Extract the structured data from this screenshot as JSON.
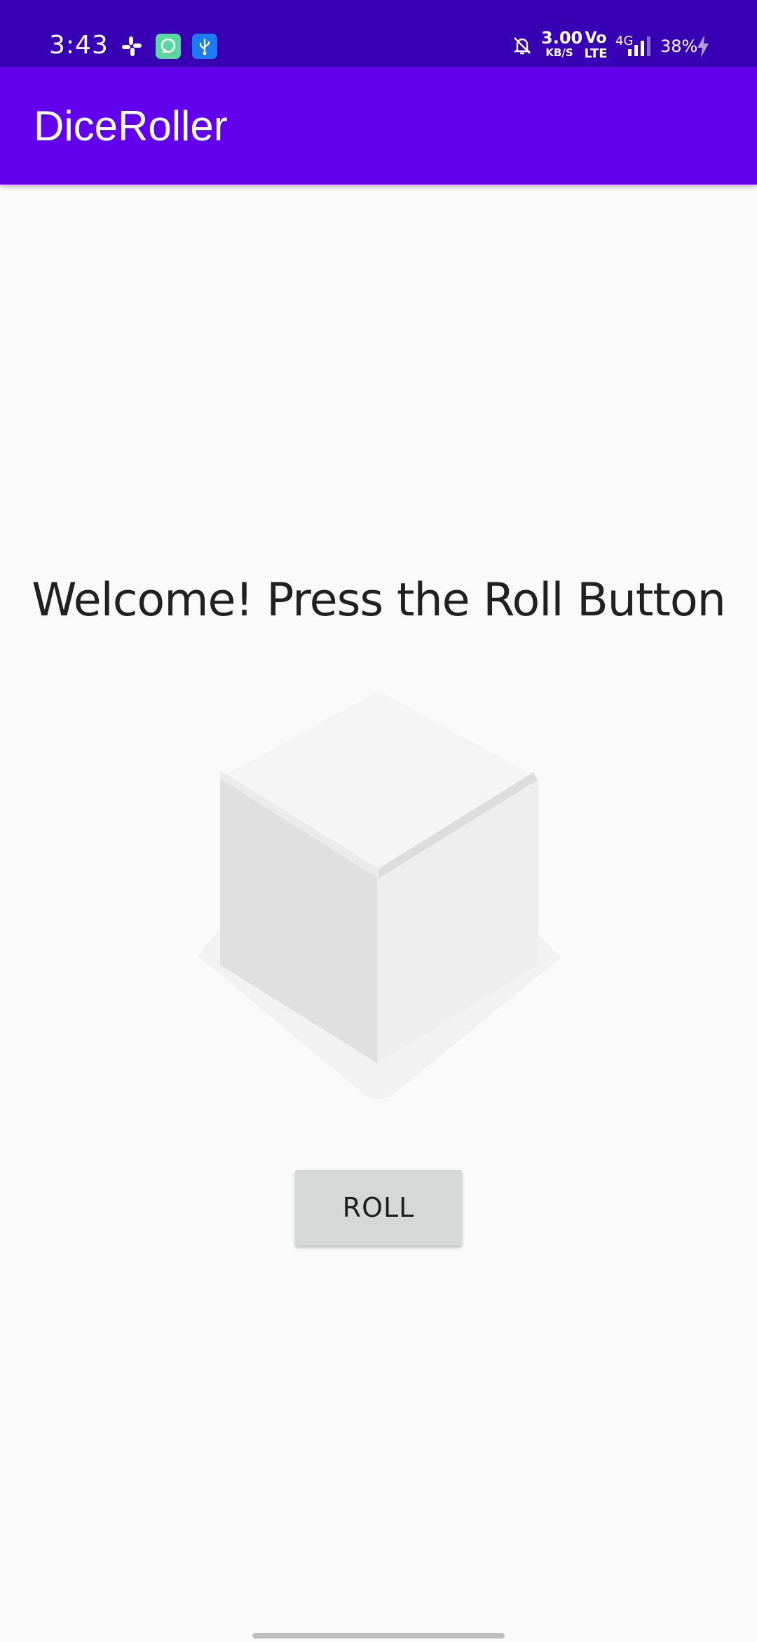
{
  "status_bar": {
    "time": "3:43",
    "net_speed_value": "3.00",
    "net_speed_unit": "KB/S",
    "volte_top": "Vo",
    "volte_bottom": "LTE",
    "network": "4G",
    "battery": "38%",
    "icons": [
      "slack-icon",
      "chat-app-icon",
      "usb-icon",
      "bell-off-icon",
      "signal-icon",
      "charging-icon"
    ]
  },
  "app_bar": {
    "title": "DiceRoller"
  },
  "main": {
    "welcome_text": "Welcome! Press the Roll Button",
    "roll_button_label": "ROLL"
  },
  "colors": {
    "status_bar": "#3700B3",
    "app_bar": "#6200EE",
    "background": "#FAFAFA",
    "button": "#D6D7D7"
  }
}
